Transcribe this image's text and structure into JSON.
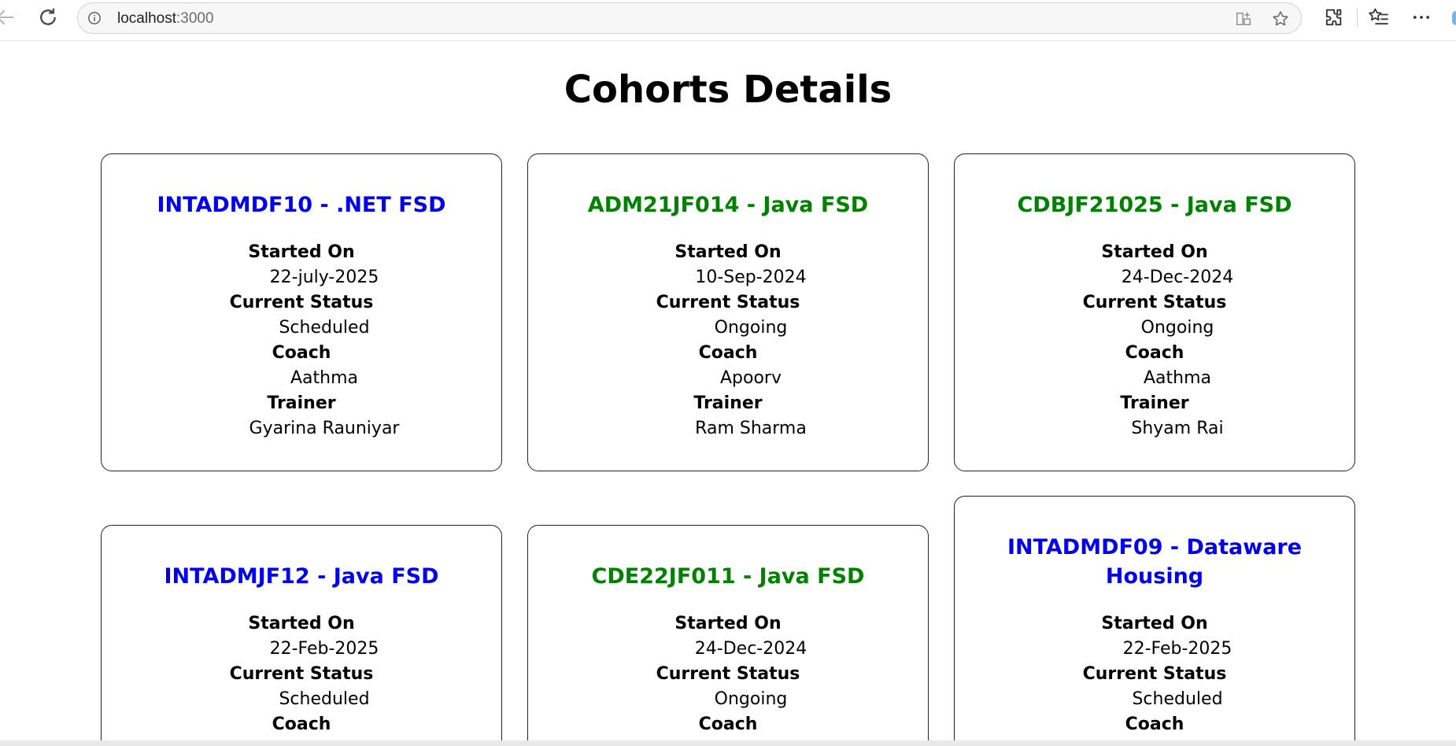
{
  "browser": {
    "url_host": "localhost",
    "url_port": ":3000"
  },
  "page": {
    "title": "Cohorts Details"
  },
  "labels": {
    "started_on": "Started On",
    "current_status": "Current Status",
    "coach": "Coach",
    "trainer": "Trainer"
  },
  "colors": {
    "scheduled": "#0000ee",
    "ongoing": "#008000"
  },
  "cohorts": [
    {
      "title": "INTADMDF10 - .NET FSD",
      "started_on": "22-july-2025",
      "status": "Scheduled",
      "coach": "Aathma",
      "trainer": "Gyarina Rauniyar"
    },
    {
      "title": "ADM21JF014 - Java FSD",
      "started_on": "10-Sep-2024",
      "status": "Ongoing",
      "coach": "Apoorv",
      "trainer": "Ram Sharma"
    },
    {
      "title": "CDBJF21025 - Java FSD",
      "started_on": "24-Dec-2024",
      "status": "Ongoing",
      "coach": "Aathma",
      "trainer": "Shyam Rai"
    },
    {
      "title": "INTADMJF12 - Java FSD",
      "started_on": "22-Feb-2025",
      "status": "Scheduled"
    },
    {
      "title": "CDE22JF011 - Java FSD",
      "started_on": "24-Dec-2024",
      "status": "Ongoing"
    },
    {
      "title": "INTADMDF09 - Dataware Housing",
      "started_on": "22-Feb-2025",
      "status": "Scheduled"
    }
  ]
}
